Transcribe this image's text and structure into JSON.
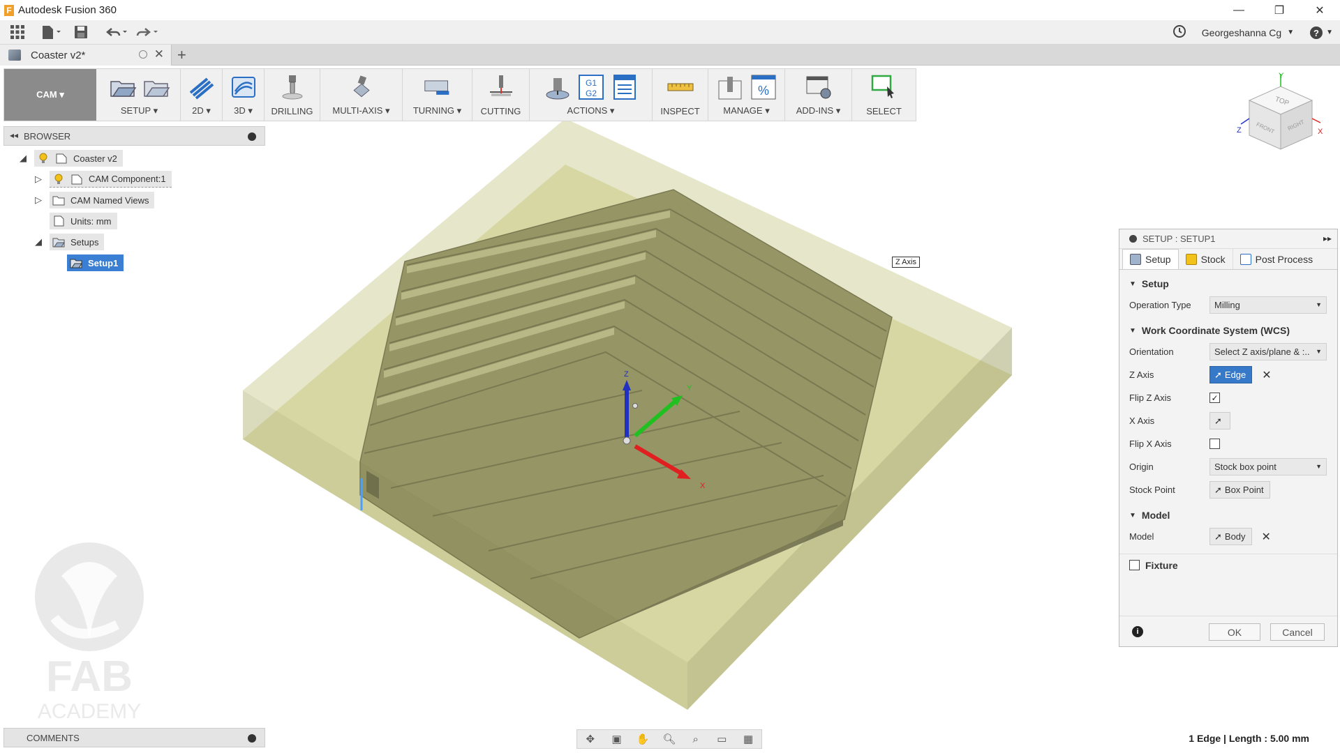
{
  "app": {
    "title": "Autodesk Fusion 360",
    "logo_letter": "F"
  },
  "window_controls": {
    "minimize": "—",
    "restore": "❐",
    "close": "✕"
  },
  "quick_access": {
    "user": "Georgeshanna Cg",
    "user_caret": "▼",
    "help_caret": "▼"
  },
  "document_tab": {
    "label": "Coaster v2*",
    "close": "✕",
    "new_tab": "+"
  },
  "toolbar": {
    "workspace": "CAM ▾",
    "groups": [
      {
        "label": "SETUP ▾"
      },
      {
        "label": "2D ▾"
      },
      {
        "label": "3D ▾"
      },
      {
        "label": "DRILLING"
      },
      {
        "label": "MULTI-AXIS ▾"
      },
      {
        "label": "TURNING ▾"
      },
      {
        "label": "CUTTING"
      },
      {
        "label": "ACTIONS ▾"
      },
      {
        "label": "INSPECT"
      },
      {
        "label": "MANAGE ▾"
      },
      {
        "label": "ADD-INS ▾"
      },
      {
        "label": "SELECT"
      }
    ],
    "actions_g1": "G1",
    "actions_g2": "G2"
  },
  "browser": {
    "title": "BROWSER",
    "collapse": "◂◂",
    "items": [
      {
        "label": "Coaster v2"
      },
      {
        "label": "CAM Component:1"
      },
      {
        "label": "CAM Named Views"
      },
      {
        "label": "Units: mm"
      },
      {
        "label": "Setups"
      },
      {
        "label": "Setup1"
      }
    ]
  },
  "setup_dialog": {
    "title": "SETUP : SETUP1",
    "expand": "▸▸",
    "tabs": [
      {
        "label": "Setup"
      },
      {
        "label": "Stock"
      },
      {
        "label": "Post Process"
      }
    ],
    "sections": {
      "setup": "Setup",
      "wcs": "Work Coordinate System (WCS)",
      "model": "Model",
      "fixture": "Fixture"
    },
    "fields": {
      "operation_type": {
        "label": "Operation Type",
        "value": "Milling"
      },
      "orientation": {
        "label": "Orientation",
        "value": "Select Z axis/plane & :.."
      },
      "z_axis": {
        "label": "Z Axis",
        "value": "Edge"
      },
      "flip_z": {
        "label": "Flip Z Axis",
        "checked": true,
        "mark": "✓"
      },
      "x_axis": {
        "label": "X Axis"
      },
      "flip_x": {
        "label": "Flip X Axis",
        "checked": false
      },
      "origin": {
        "label": "Origin",
        "value": "Stock box point"
      },
      "stock_point": {
        "label": "Stock Point",
        "value": "Box Point"
      },
      "model": {
        "label": "Model",
        "value": "Body"
      }
    },
    "ok": "OK",
    "cancel": "Cancel",
    "info": "i",
    "clear": "✕"
  },
  "viewport": {
    "z_axis_tooltip": "Z Axis",
    "triad": {
      "x": "X",
      "y": "Y",
      "z": "Z"
    },
    "viewcube": {
      "top": "TOP",
      "front": "FRONT",
      "right": "RIGHT",
      "x": "X",
      "y": "Y",
      "z": "Z"
    },
    "watermark_line1": "FAB",
    "watermark_line2": "ACADEMY"
  },
  "comments": {
    "title": "COMMENTS"
  },
  "status": {
    "text": "1 Edge | Length : 5.00 mm"
  },
  "colors": {
    "accent": "#3779c9",
    "stock_box": "#d9d99a",
    "part": "#6b6b45",
    "axis_x": "#e02020",
    "axis_y": "#20c020",
    "axis_z": "#2030c0"
  }
}
